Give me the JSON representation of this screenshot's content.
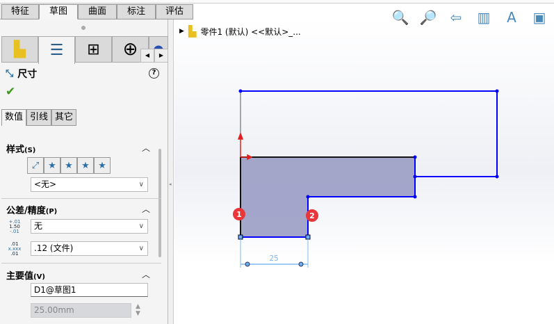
{
  "command_tabs": [
    "特征",
    "草图",
    "曲面",
    "标注",
    "评估"
  ],
  "active_command_tab": "草图",
  "property_tabs": [
    "feature-manager",
    "property-manager",
    "configuration-manager",
    "dimxpert-manager",
    "display-manager"
  ],
  "panel": {
    "title": "尺寸",
    "help": "?",
    "ok": "✔",
    "subtabs": [
      "数值",
      "引线",
      "其它"
    ],
    "style": {
      "label": "样式",
      "key": "(S)",
      "select": "<无>"
    },
    "tolerance": {
      "label": "公差/精度",
      "key": "(P)",
      "tol_icon": [
        "+.01",
        "1.50",
        "-.01"
      ],
      "prec_icon": [
        ".01",
        "x.xxx",
        ".01"
      ],
      "tol_select": "无",
      "prec_select": ".12 (文件)"
    },
    "primary": {
      "label": "主要值",
      "key": "(V)",
      "name": "D1@草图1",
      "value": "25.00mm"
    }
  },
  "tree": {
    "label": "零件1 (默认) <<默认>_..."
  },
  "sketch": {
    "dimension": "25",
    "badges": [
      "1",
      "2"
    ]
  },
  "colors": {
    "sketch_line": "#0000ff",
    "fill": "#9a9cc4",
    "dimension": "#7fb8f0",
    "badge": "#e8363a"
  }
}
